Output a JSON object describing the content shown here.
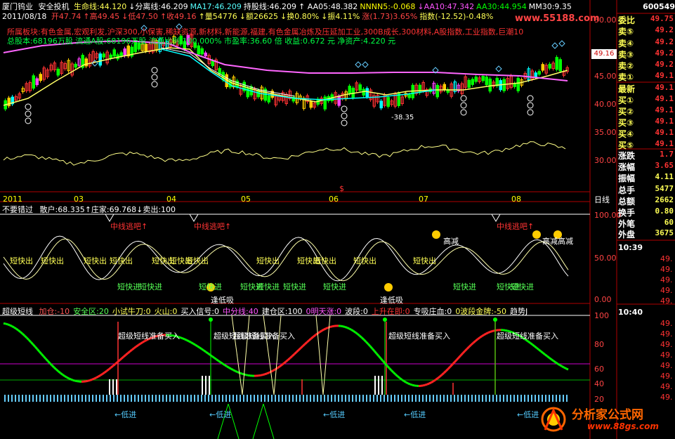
{
  "header": {
    "stock_name": "厦门钨业",
    "system": "安全投机",
    "lines": [
      {
        "label": "生命线:",
        "value": "44.120",
        "color": "#ffff55"
      },
      {
        "label": "↓分离线:",
        "value": "46.209",
        "color": "#ffffff"
      },
      {
        "label": "MA17:",
        "value": "46.209",
        "color": "#55ffff"
      },
      {
        "label": "持股线:",
        "value": "46.209",
        "color": "#ffffff"
      },
      {
        "label": "↑ AA05:",
        "value": "48.382",
        "color": "#ffffff"
      },
      {
        "label": "NNNN5:",
        "value": "-0.068",
        "color": "#ffff00"
      },
      {
        "label": "↓AA10:",
        "value": "47.342",
        "color": "#ff55ff"
      },
      {
        "label": "AA30:",
        "value": "44.954",
        "color": "#00ff00"
      },
      {
        "label": "MM30:",
        "value": "9.35",
        "color": "#ffffff"
      }
    ],
    "date": "2011/08/18",
    "ohlc": [
      {
        "label": "开",
        "value": "47.74",
        "color": "#ff4444"
      },
      {
        "label": "↑高",
        "value": "49.45",
        "color": "#ff4444"
      },
      {
        "label": "↓低",
        "value": "47.50",
        "color": "#ff4444"
      },
      {
        "label": "↑收",
        "value": "49.16",
        "color": "#ff4444"
      },
      {
        "label": "↑量",
        "value": "54776",
        "color": "#ffff55"
      },
      {
        "label": "↓额",
        "value": "26625",
        "color": "#ffff55"
      },
      {
        "label": "↓换",
        "value": "0.80%",
        "color": "#ffff55"
      },
      {
        "label": "↓振",
        "value": "4.11%",
        "color": "#ffff55"
      },
      {
        "label": "涨",
        "value": "(1.73)3.65%",
        "color": "#ff4444"
      },
      {
        "label": "指数",
        "value": "(-12.52)-0.48%",
        "color": "#ffff55"
      }
    ],
    "sector": "所属板块:有色金属,宏观利发,沪深300,小保害,稀缺资源,新材料,新能源,福建,有色金属冶炼及压延加工业,300B成长,300材料,A股指数,工业指数,巨潮10",
    "capital": "总股本:68196万股 流通A股:68196万股 流通比例:100.000% 市盈率:36.60 倍 收益:0.672 元 净资产:4.220 元"
  },
  "watermark": "www.55188.com",
  "price_tag": "49.16",
  "lowest_label": "-38.35",
  "main_axis": [
    "50.00",
    "45.00",
    "40.00",
    "35.00",
    "30.00"
  ],
  "months": [
    "2011",
    "03",
    "04",
    "05",
    "06",
    "07",
    "08"
  ],
  "period": "日线",
  "ind1": {
    "title": "不要错过",
    "vals": "散户:68.335↑庄家:69.768↓卖出:100",
    "axis": [
      "100.00",
      "50.00",
      "0.00"
    ],
    "escape": [
      "中线逃吧↑",
      "中线逃吧↑",
      "中线逃吧↑"
    ],
    "high": [
      "高减",
      "高减高减"
    ],
    "short_out": [
      "短快出",
      "短快出",
      "短快出",
      "短快出",
      "短快出",
      "短快出",
      "短快出",
      "短快出",
      "短快出",
      "短快出",
      "短快出",
      "短快出"
    ],
    "short_in": [
      "短快进",
      "短快进",
      "短快进",
      "短快进",
      "短快进",
      "短快进",
      "短快进",
      "短快进",
      "短快进",
      "短快进"
    ],
    "low_buy": [
      "逢低吸",
      "逢低吸"
    ]
  },
  "ind2": {
    "title": "超级短线",
    "vals": [
      {
        "label": "加仓:",
        "value": "-10",
        "color": "#ff5555"
      },
      {
        "label": "安全区:",
        "value": "20",
        "color": "#55ff55"
      },
      {
        "label": "小试牛刀:",
        "value": "0",
        "color": "#ffff55"
      },
      {
        "label": "火山:",
        "value": "0",
        "color": "#ffff55"
      },
      {
        "label": "买入信号:",
        "value": "0",
        "color": "#ffffff"
      },
      {
        "label": "中分线:",
        "value": "40",
        "color": "#ff55ff"
      },
      {
        "label": "建仓区:",
        "value": "100",
        "color": "#ffffff"
      },
      {
        "label": "0",
        "value": "明天涨:0",
        "color": "#ff55ff"
      },
      {
        "label": "波段:",
        "value": "0",
        "color": "#ffffff"
      },
      {
        "label": "上升在即:",
        "value": "0",
        "color": "#ff3333"
      },
      {
        "label": "专吸庄血:",
        "value": "0",
        "color": "#ffffff"
      },
      {
        "label": "0",
        "value": "波段金牌:-50",
        "color": "#ffff55"
      },
      {
        "label": "趋势J",
        "value": "",
        "color": "#ffffff"
      }
    ],
    "axis": [
      "100",
      "80",
      "60",
      "40",
      "20"
    ],
    "prep": [
      "超级短线准备买入",
      "超级短线准备买入",
      "超级短线准备买入",
      "超级短线准备买入",
      "超级短线准备买入"
    ],
    "low_in": [
      "←低进",
      "←低进",
      "←低进",
      "←低进",
      "←低进"
    ]
  },
  "quote": {
    "code": "600549",
    "rows": [
      {
        "label": "委比",
        "value": "49.75"
      },
      {
        "label": "卖⑤",
        "value": "49.2"
      },
      {
        "label": "卖④",
        "value": "49.2"
      },
      {
        "label": "卖③",
        "value": "49.2"
      },
      {
        "label": "卖②",
        "value": "49.2"
      },
      {
        "label": "卖①",
        "value": "49.1"
      },
      {
        "label": "最新",
        "value": "49.1"
      },
      {
        "label": "买①",
        "value": "49.1"
      },
      {
        "label": "买②",
        "value": "49.1"
      },
      {
        "label": "买③",
        "value": "49.1"
      },
      {
        "label": "买④",
        "value": "49.1"
      },
      {
        "label": "买⑤",
        "value": "49.1"
      },
      {
        "label": "涨跌",
        "value": "1.7"
      },
      {
        "label": "涨幅",
        "value": "3.65"
      },
      {
        "label": "振幅",
        "value": "4.11"
      },
      {
        "label": "总手",
        "value": "5477"
      },
      {
        "label": "总额",
        "value": "2662"
      },
      {
        "label": "换手",
        "value": "0.80"
      },
      {
        "label": "外笔",
        "value": "60"
      },
      {
        "label": "外盘",
        "value": "3675"
      }
    ],
    "ticks1_time": "10:39",
    "ticks1": [
      "49.",
      "49.",
      "49.",
      "49.",
      "49."
    ],
    "ticks2_time": "10:40",
    "ticks2": [
      "49.",
      "49.",
      "49.",
      "49.",
      "49.",
      "49.",
      "49.",
      "49.",
      "49.",
      "49."
    ]
  },
  "logo": {
    "name": "分析家公式网",
    "url": "www.88gs.com"
  },
  "colors": {
    "up": "#ff3333",
    "down": "#00ffff",
    "frame": "#b00000"
  }
}
